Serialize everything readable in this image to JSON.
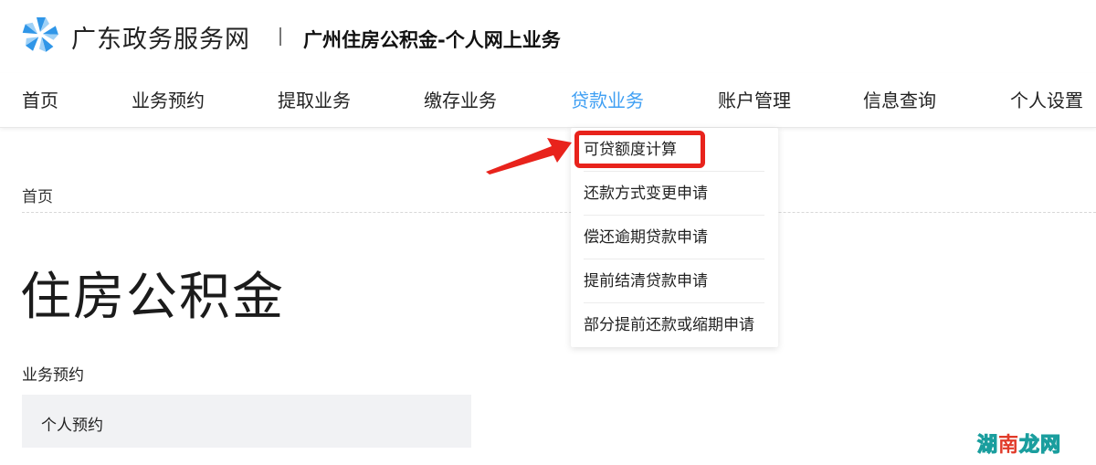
{
  "header": {
    "site_name": "广东政务服务网",
    "subtitle": "广州住房公积金-个人网上业务"
  },
  "nav": {
    "items": [
      {
        "label": "首页"
      },
      {
        "label": "业务预约"
      },
      {
        "label": "提取业务"
      },
      {
        "label": "缴存业务"
      },
      {
        "label": "贷款业务",
        "active": true
      },
      {
        "label": "账户管理"
      },
      {
        "label": "信息查询"
      },
      {
        "label": "个人设置"
      }
    ]
  },
  "breadcrumb": "首页",
  "page_title": "住房公积金",
  "section": {
    "label": "业务预约",
    "card_label": "个人预约"
  },
  "dropdown": {
    "items": [
      {
        "label": "可贷额度计算",
        "highlighted": true
      },
      {
        "label": "还款方式变更申请"
      },
      {
        "label": "偿还逾期贷款申请"
      },
      {
        "label": "提前结清贷款申请"
      },
      {
        "label": "部分提前还款或缩期申请"
      }
    ]
  },
  "watermark": {
    "part1": "湖",
    "part2": "南",
    "part3": "龙网"
  },
  "colors": {
    "active_nav": "#3f9ff3",
    "highlight_red": "#e8231c",
    "logo_blue": "#2f96e8"
  }
}
